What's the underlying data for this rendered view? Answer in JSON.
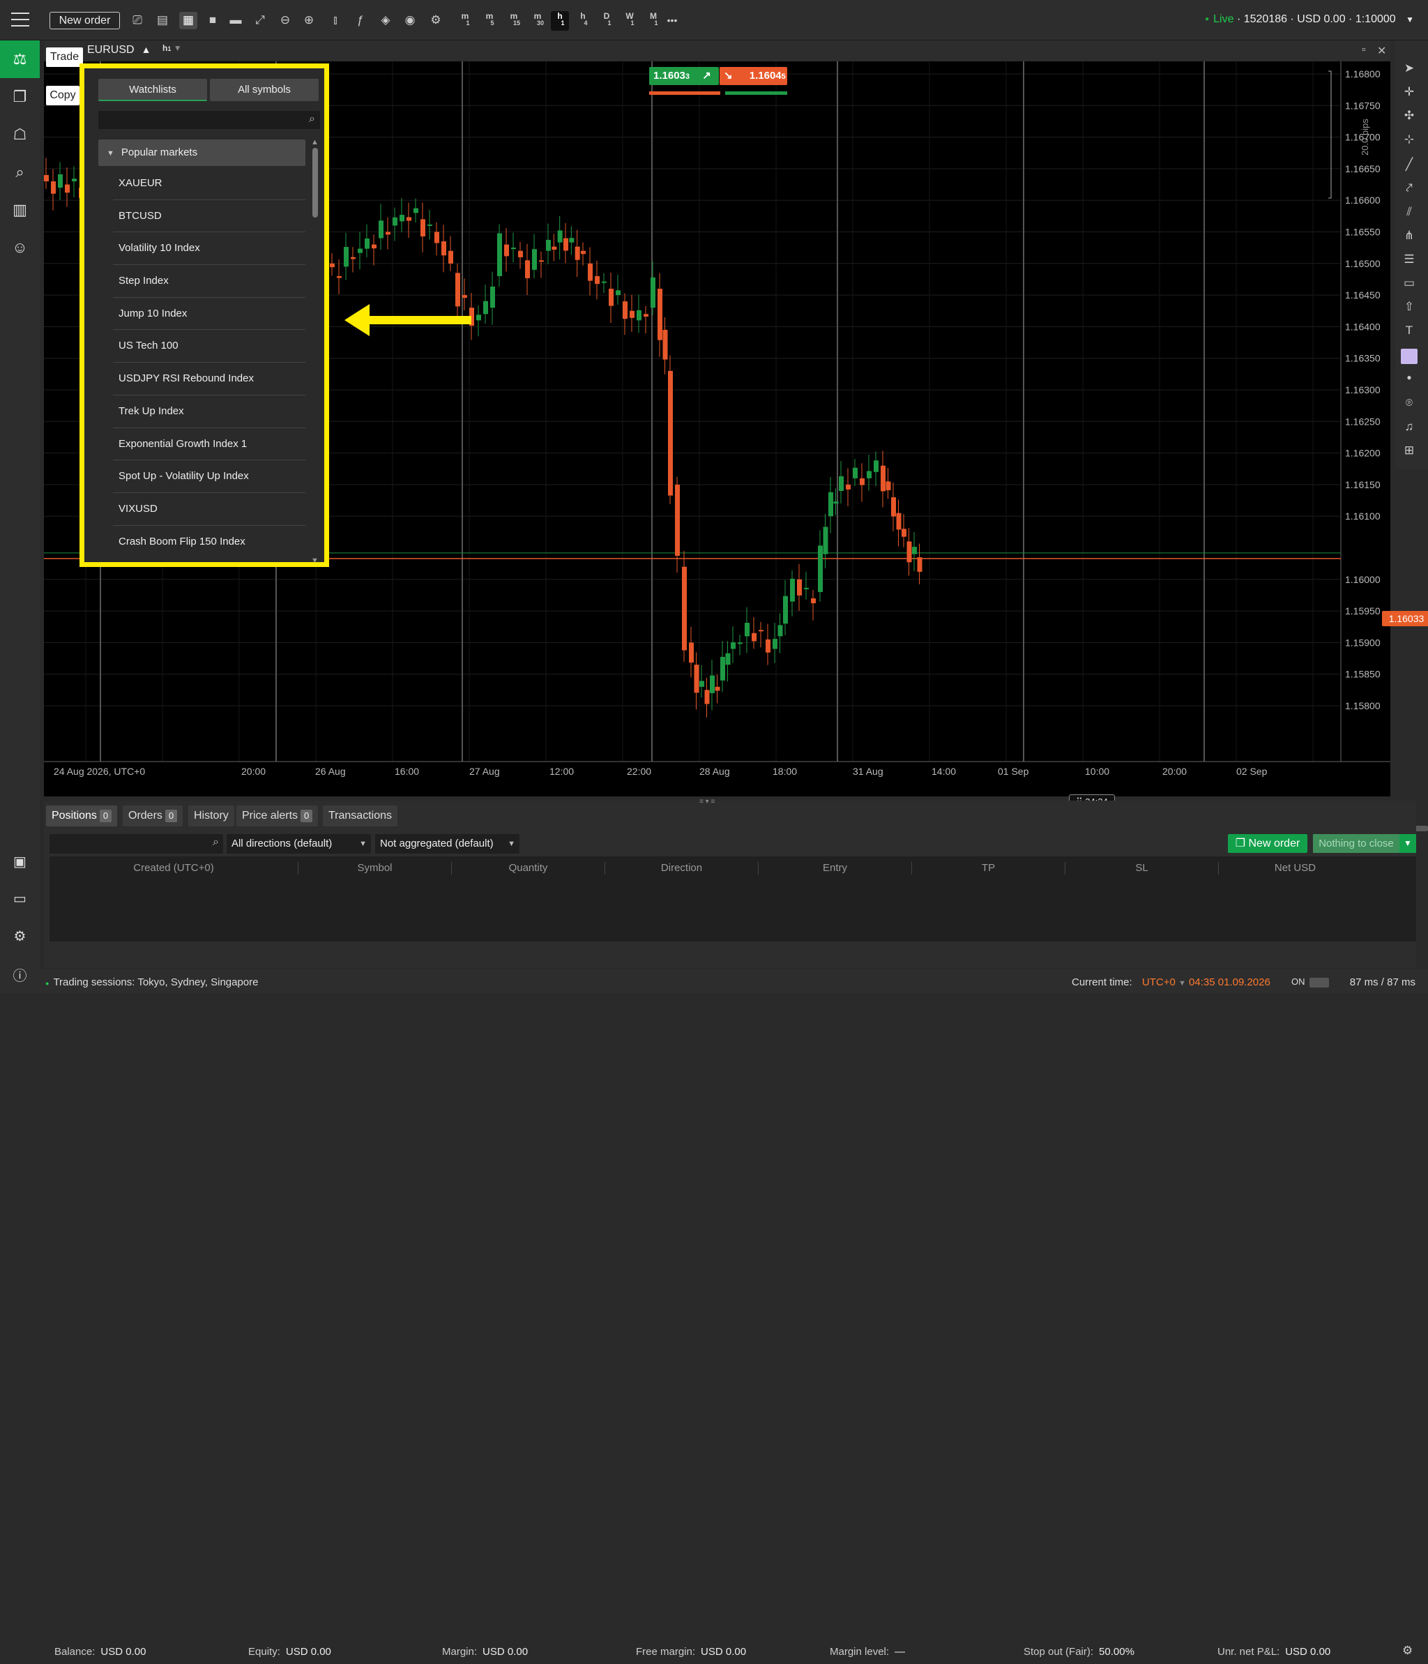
{
  "toolbar": {
    "new_order_label": "New order",
    "timeframes": [
      {
        "main": "m",
        "sub": "1"
      },
      {
        "main": "m",
        "sub": "5"
      },
      {
        "main": "m",
        "sub": "15"
      },
      {
        "main": "m",
        "sub": "30"
      },
      {
        "main": "h",
        "sub": "1"
      },
      {
        "main": "h",
        "sub": "4"
      },
      {
        "main": "D",
        "sub": "1"
      },
      {
        "main": "W",
        "sub": "1"
      },
      {
        "main": "M",
        "sub": "1"
      }
    ],
    "selected_timeframe": "h1",
    "more_label": "•••"
  },
  "account": {
    "status": "Live",
    "details": "· 1520186 · USD 0.00 · 1:10000"
  },
  "chart": {
    "symbol": "EURUSD",
    "symbol_arrow": "▲",
    "tf_main": "h",
    "tf_sub": "1",
    "trade_label": "Trade",
    "copy_label": "Copy",
    "bid_main": "1.1603",
    "bid_small": "3",
    "ask_main": "1.1604",
    "ask_small": "5",
    "pips_label": "20.0 pips",
    "current_price": "1.16033",
    "time_badge": "24:24",
    "price_axis": [
      "1.16800",
      "1.16750",
      "1.16700",
      "1.16650",
      "1.16600",
      "1.16550",
      "1.16500",
      "1.16450",
      "1.16400",
      "1.16350",
      "1.16300",
      "1.16250",
      "1.16200",
      "1.16150",
      "1.16100",
      "1.16000",
      "1.15950",
      "1.15900",
      "1.15850",
      "1.15800"
    ],
    "time_axis": [
      "24 Aug 2026, UTC+0",
      "20:00",
      "26 Aug",
      "16:00",
      "27 Aug",
      "12:00",
      "22:00",
      "28 Aug",
      "18:00",
      "31 Aug",
      "14:00",
      "01 Sep",
      "10:00",
      "20:00",
      "02 Sep"
    ]
  },
  "watchlist": {
    "tab_watchlists": "Watchlists",
    "tab_all_symbols": "All symbols",
    "search_placeholder": "",
    "group_name": "Popular markets",
    "items": [
      "XAUEUR",
      "BTCUSD",
      "Volatility 10 Index",
      "Step Index",
      "Jump 10 Index",
      "US Tech 100",
      "USDJPY RSI Rebound Index",
      "Trek Up Index",
      "Exponential Growth Index 1",
      "Spot Up - Volatility Up Index",
      "VIXUSD",
      "Crash Boom Flip 150 Index"
    ]
  },
  "positions": {
    "tabs": [
      {
        "label": "Positions",
        "count": "0"
      },
      {
        "label": "Orders",
        "count": "0"
      },
      {
        "label": "History",
        "count": null
      },
      {
        "label": "Price alerts",
        "count": "0"
      },
      {
        "label": "Transactions",
        "count": null
      }
    ],
    "direction_filter": "All directions (default)",
    "aggregation_filter": "Not aggregated (default)",
    "new_order_label": "New order",
    "nothing_to_close_label": "Nothing to close",
    "columns": [
      "Created (UTC+0)",
      "Symbol",
      "Quantity",
      "Direction",
      "Entry",
      "TP",
      "SL",
      "Net USD"
    ]
  },
  "summary": {
    "balance_label": "Balance:",
    "balance": "USD 0.00",
    "equity_label": "Equity:",
    "equity": "USD 0.00",
    "margin_label": "Margin:",
    "margin": "USD 0.00",
    "free_margin_label": "Free margin:",
    "free_margin": "USD 0.00",
    "margin_level_label": "Margin level:",
    "margin_level": "—",
    "stop_out_label": "Stop out (Fair):",
    "stop_out": "50.00%",
    "unr_label": "Unr. net P&L:",
    "unr": "USD 0.00"
  },
  "status": {
    "sessions": "Trading sessions: Tokyo, Sydney, Singapore",
    "current_time_label": "Current time:",
    "timezone": "UTC+0",
    "time": "04:35 01.09.2026",
    "on_label": "ON",
    "ping": "87 ms / 87 ms"
  },
  "colors": {
    "bull": "#1e9a45",
    "bear": "#e8582a",
    "highlight": "#ffec00",
    "brand": "#12a14a"
  }
}
